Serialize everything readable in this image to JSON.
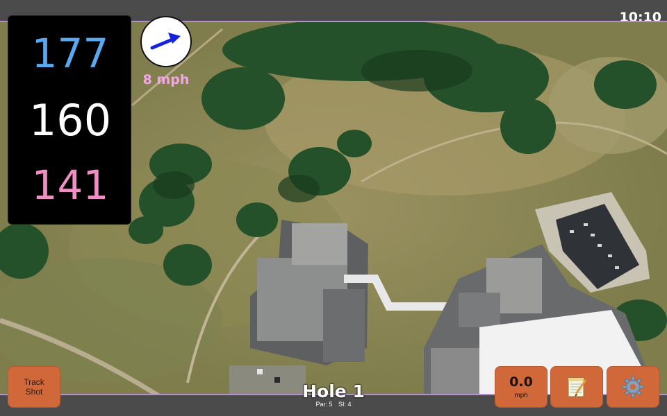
{
  "status": {
    "time": "10:10"
  },
  "yardages": {
    "back": "177",
    "middle": "160",
    "front": "141",
    "colors": {
      "back": "#5aa9f0",
      "middle": "#ffffff",
      "front": "#f08fc4"
    }
  },
  "wind": {
    "label": "8 mph",
    "label_color": "#f2a6e6",
    "arrow_color": "#1523e0",
    "arrow_icon": "arrow-up-right-icon"
  },
  "buttons": {
    "track_shot": {
      "line1": "Track",
      "line2": "Shot"
    },
    "speed": {
      "value": "0.0",
      "unit": "mph"
    },
    "notes_icon": "notepad-icon",
    "settings_icon": "gear-icon",
    "accent": "#d1683a"
  },
  "hole": {
    "title": "Hole 1",
    "par": "Par: 5",
    "si": "SI: 4"
  }
}
